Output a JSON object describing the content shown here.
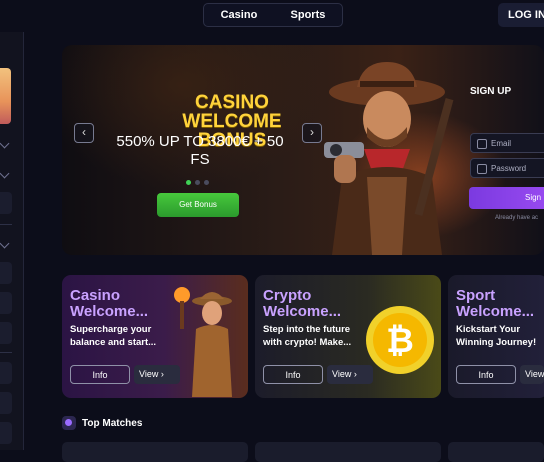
{
  "header": {
    "tabs": [
      {
        "label": "Casino"
      },
      {
        "label": "Sports"
      }
    ],
    "login_label": "LOG IN"
  },
  "hero": {
    "title": "CASINO WELCOME BONUS",
    "subtitle": "550% UP TO 3800€ + 50 FS",
    "cta_label": "Get Bonus",
    "prev_arrow": "‹",
    "next_arrow": "›",
    "slide_index": 1,
    "slide_count": 3
  },
  "signup": {
    "title": "SIGN UP",
    "email_placeholder": "Email",
    "password_placeholder": "Password",
    "button_label": "Sign",
    "have_account": "Already have ac"
  },
  "promo_cards": [
    {
      "title_line1": "Casino",
      "title_line2": "Welcome...",
      "desc": "Supercharge your balance and start...",
      "info": "Info",
      "view": "View ›"
    },
    {
      "title_line1": "Crypto",
      "title_line2": "Welcome...",
      "desc": "Step into the future with crypto!  Make...",
      "info": "Info",
      "view": "View ›"
    },
    {
      "title_line1": "Sport",
      "title_line2": "Welcome...",
      "desc": "Kickstart Your Winning Journey!",
      "info": "Info",
      "view": "View"
    }
  ],
  "sections": {
    "top_matches": "Top Matches"
  },
  "colors": {
    "accent_green": "#3fd256",
    "title_yellow": "#ffd33b",
    "signup_purple": "#8b44ec",
    "card_title_purple": "#c9a2ff"
  }
}
